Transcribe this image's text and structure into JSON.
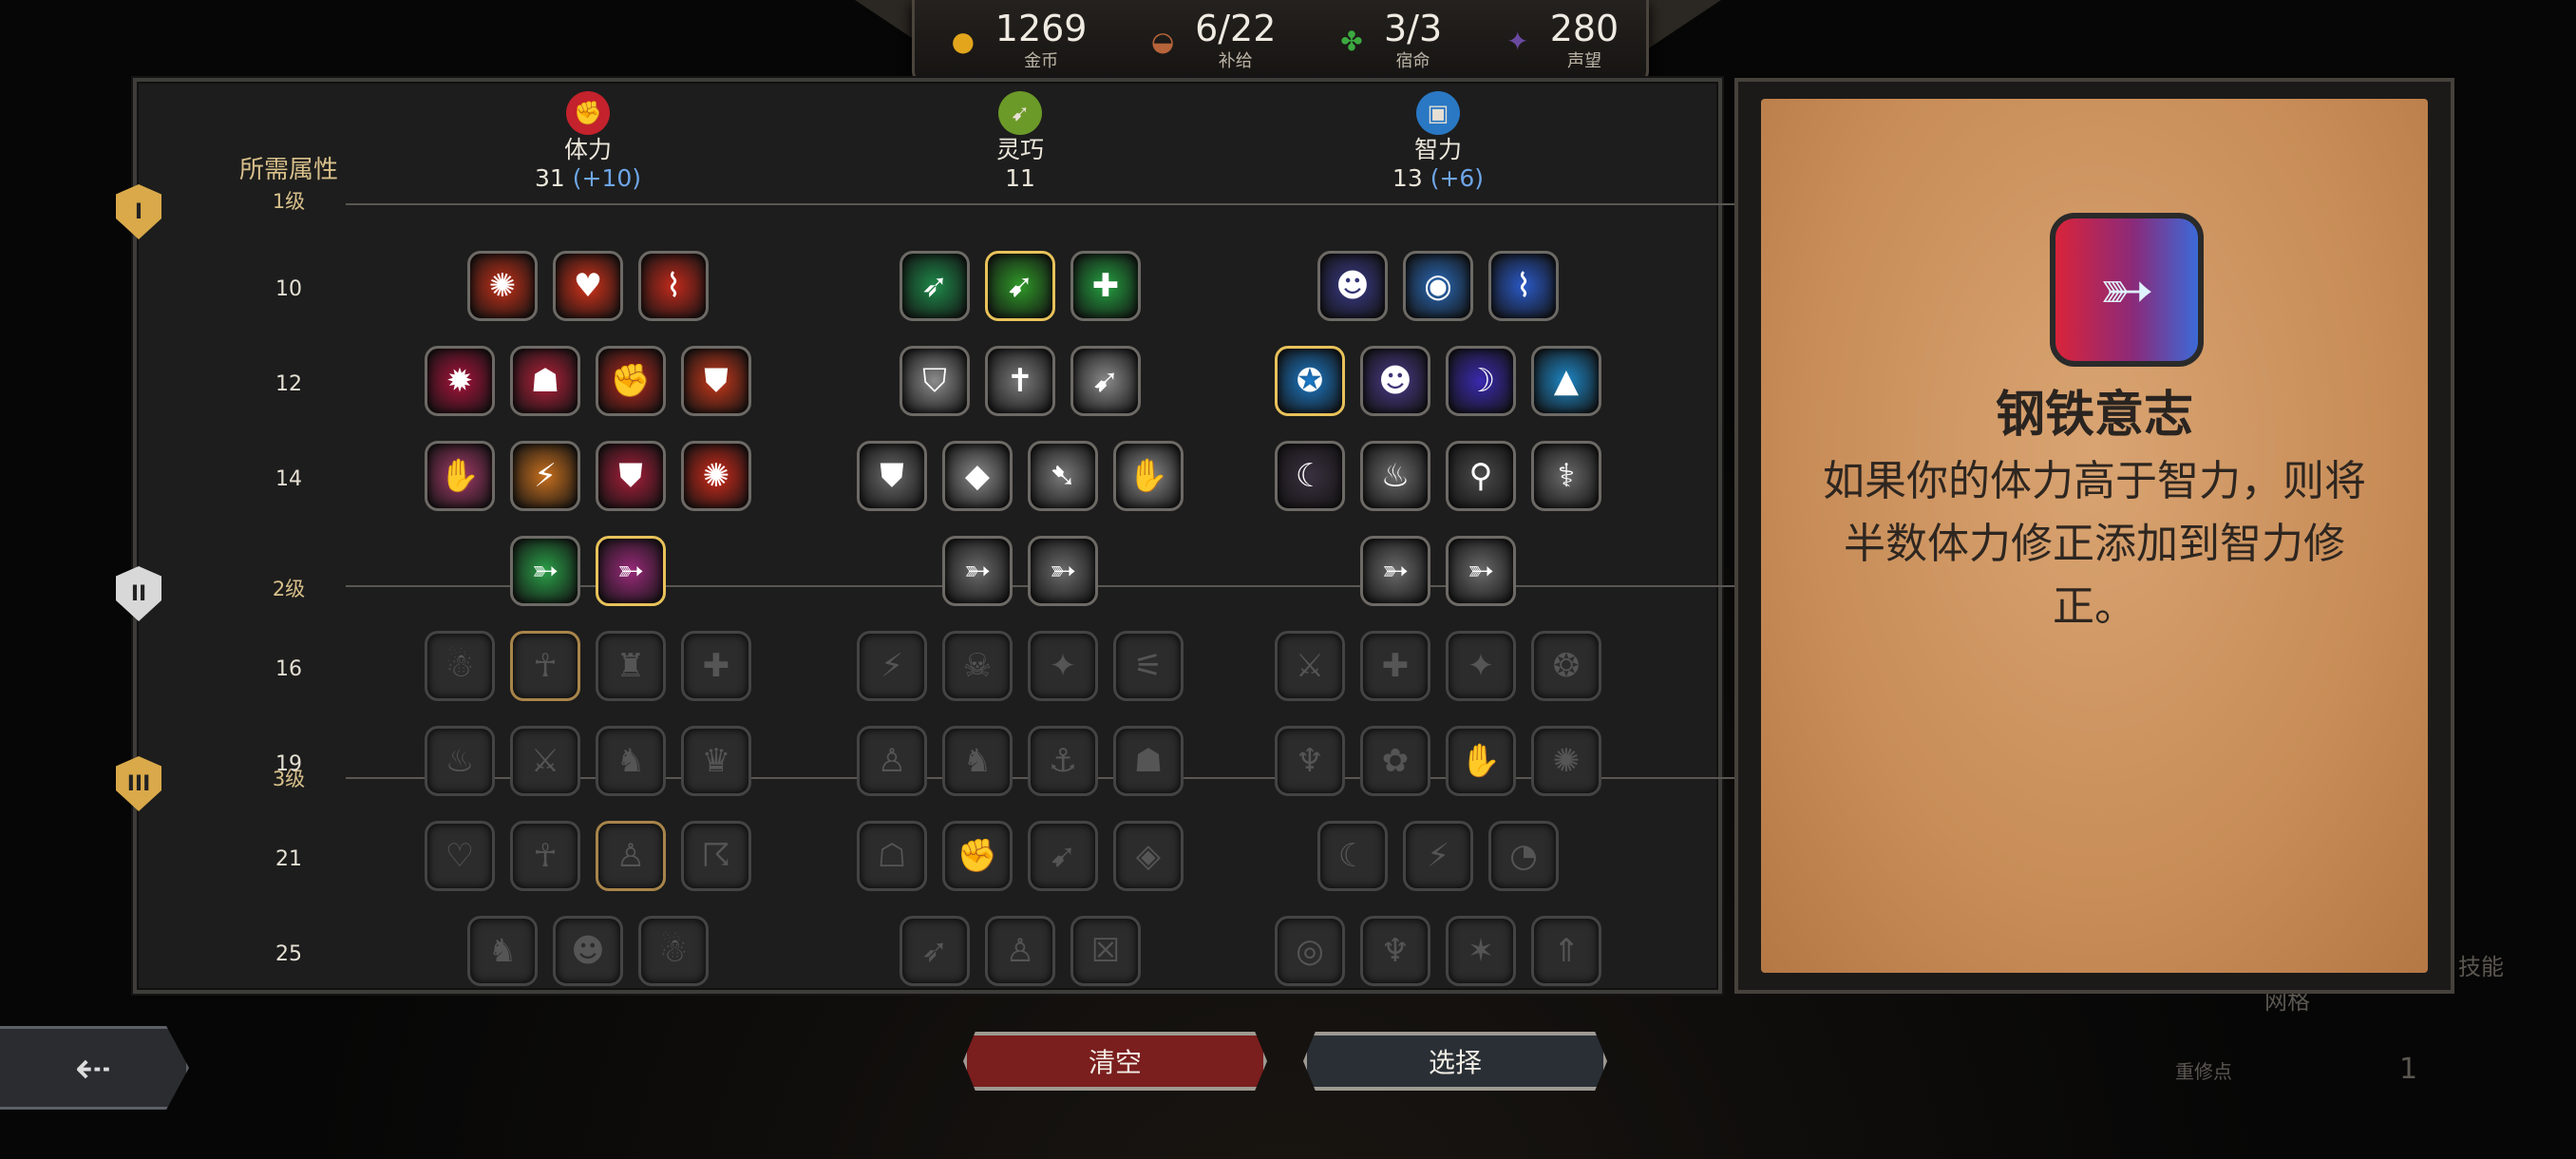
{
  "resources": [
    {
      "icon": "coin-icon",
      "value": "1269",
      "label": "金币",
      "color": "#e2a51c"
    },
    {
      "icon": "supply-bag-icon",
      "value": "6/22",
      "label": "补给",
      "color": "#b7643a"
    },
    {
      "icon": "clover-icon",
      "value": "3/3",
      "label": "宿命",
      "color": "#3caa40"
    },
    {
      "icon": "renown-gem-icon",
      "value": "280",
      "label": "声望",
      "color": "#6a4aa0"
    }
  ],
  "requirements_title": "所需属性",
  "tiers": [
    {
      "label": "1级",
      "badge": "I"
    },
    {
      "label": "2级",
      "badge": "II"
    },
    {
      "label": "3级",
      "badge": "III"
    }
  ],
  "row_levels": [
    "10",
    "12",
    "14",
    "",
    "16",
    "19",
    "21",
    "25"
  ],
  "attributes": [
    {
      "name": "体力",
      "value": "31",
      "bonus": "(+10)",
      "icon": "fist-icon",
      "color": "#c4222c"
    },
    {
      "name": "灵巧",
      "value": "11",
      "bonus": "",
      "icon": "agility-icon",
      "color": "#6b9a28"
    },
    {
      "name": "智力",
      "value": "13",
      "bonus": "(+6)",
      "icon": "book-icon",
      "color": "#2a78c4"
    }
  ],
  "selected_skill": {
    "name": "钢铁意志",
    "description": "如果你的体力高于智力，则将半数体力修正添加到智力修正。",
    "icon": "iron-will-icon"
  },
  "buttons": {
    "clear": "清空",
    "select": "选择",
    "back": "⇠"
  },
  "background_labels": {
    "skills": "技能",
    "grid": "网格",
    "respec": "重修点",
    "respec_value": "1"
  }
}
